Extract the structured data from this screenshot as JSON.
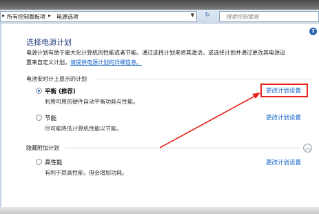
{
  "address_bar": {
    "crumb1": "所有控制面板项",
    "separator": "▸",
    "crumb2": "电源选项",
    "search_placeholder": "搜索控制面板"
  },
  "help_label": "?",
  "header": {
    "title": "选择电源计划",
    "desc_line1": "电源计划有助于最大化计算机的性能或者节能。通过选择计划来将其激活，或选择计划并通过更改其电源设",
    "desc_line2_prefix": "置来自定义计划。",
    "desc_link": "请提供电源计划的详细信息。"
  },
  "battery_section": {
    "label": "电池安时计上显示的计划",
    "plans": [
      {
        "name": "平衡 (推荐)",
        "desc": "利用可用的硬件自动平衡功耗与性能。",
        "change": "更改计划设置",
        "selected": true
      },
      {
        "name": "节能",
        "desc": "尽可能降低计算机性能以节能。",
        "change": "更改计划设置",
        "selected": false
      }
    ]
  },
  "hidden_section": {
    "label": "隐藏附加计划",
    "plans": [
      {
        "name": "高性能",
        "desc": "有利于提高性能，但会增加功耗。",
        "change": "更改计划设置",
        "selected": false
      }
    ]
  },
  "colors": {
    "accent": "#0a5ec7",
    "title": "#1f3d7a",
    "annotation": "#e5231b"
  },
  "icons": [
    "chevron-right-icon",
    "dropdown-arrow-icon",
    "refresh-icon",
    "help-icon",
    "collapse-up-icon",
    "radio-icon"
  ]
}
